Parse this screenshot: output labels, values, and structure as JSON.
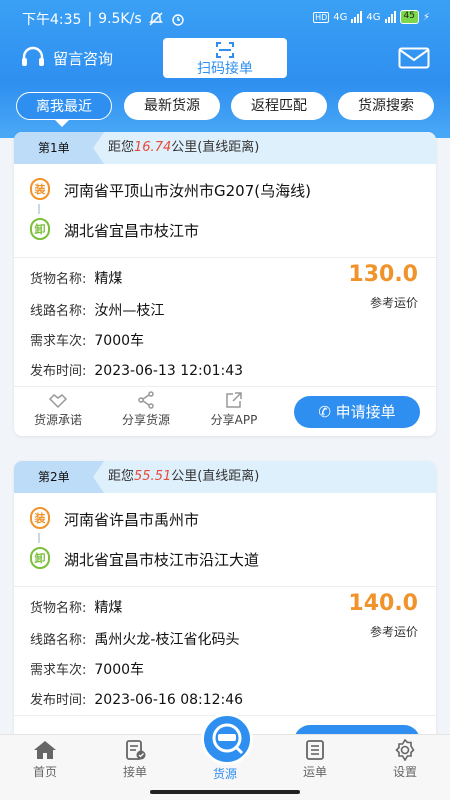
{
  "status": {
    "time": "下午4:35",
    "speed": "9.5K/s",
    "hd": "HD",
    "net1": "4G",
    "net2": "4G",
    "battery": "45"
  },
  "topbar": {
    "consult": "留言咨询",
    "scan": "扫码接单"
  },
  "tabs": [
    "离我最近",
    "最新货源",
    "返程匹配",
    "货源搜索"
  ],
  "labels": {
    "load": "装",
    "unload": "卸",
    "goods": "货物名称:",
    "line": "线路名称:",
    "trips": "需求车次:",
    "time": "发布时间:",
    "ref_price": "参考运价",
    "dist_prefix": "距您",
    "dist_suffix": "公里(直线距离)",
    "promise": "货源承诺",
    "share_goods": "分享货源",
    "share_app": "分享APP",
    "apply": "申请接单"
  },
  "orders": [
    {
      "no": "第1单",
      "distance": "16.74",
      "from": "河南省平顶山市汝州市G207(乌海线)",
      "to": "湖北省宜昌市枝江市",
      "goods": "精煤",
      "line": "汝州—枝江",
      "trips": "7000车",
      "time": "2023-06-13 12:01:43",
      "price": "130.0"
    },
    {
      "no": "第2单",
      "distance": "55.51",
      "from": "河南省许昌市禹州市",
      "to": "湖北省宜昌市枝江市沿江大道",
      "goods": "精煤",
      "line": "禹州火龙-枝江省化码头",
      "trips": "7000车",
      "time": "2023-06-16 08:12:46",
      "price": "140.0"
    }
  ],
  "nav": [
    "首页",
    "接单",
    "货源",
    "运单",
    "设置"
  ],
  "colors": {
    "primary": "#2f8ff0",
    "price": "#f0932b",
    "distance": "#e84a3a"
  }
}
